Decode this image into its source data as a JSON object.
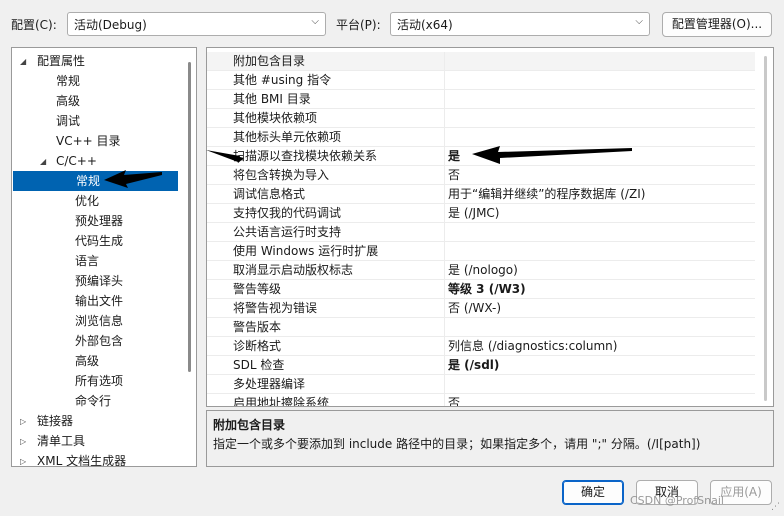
{
  "header": {
    "config_label": "配置(C):",
    "config_value": "活动(Debug)",
    "platform_label": "平台(P):",
    "platform_value": "活动(x64)",
    "config_manager_button": "配置管理器(O)..."
  },
  "tree": {
    "items": [
      {
        "label": "配置属性",
        "toggle": "◢"
      },
      {
        "label": "常规",
        "toggle": ""
      },
      {
        "label": "高级",
        "toggle": ""
      },
      {
        "label": "调试",
        "toggle": ""
      },
      {
        "label": "VC++ 目录",
        "toggle": ""
      },
      {
        "label": "C/C++",
        "toggle": "◢"
      },
      {
        "label": "常规",
        "toggle": "",
        "selected": true
      },
      {
        "label": "优化",
        "toggle": ""
      },
      {
        "label": "预处理器",
        "toggle": ""
      },
      {
        "label": "代码生成",
        "toggle": ""
      },
      {
        "label": "语言",
        "toggle": ""
      },
      {
        "label": "预编译头",
        "toggle": ""
      },
      {
        "label": "输出文件",
        "toggle": ""
      },
      {
        "label": "浏览信息",
        "toggle": ""
      },
      {
        "label": "外部包含",
        "toggle": ""
      },
      {
        "label": "高级",
        "toggle": ""
      },
      {
        "label": "所有选项",
        "toggle": ""
      },
      {
        "label": "命令行",
        "toggle": ""
      },
      {
        "label": "链接器",
        "toggle": "▷"
      },
      {
        "label": "清单工具",
        "toggle": "▷"
      },
      {
        "label": "XML 文档生成器",
        "toggle": "▷"
      }
    ]
  },
  "properties": [
    {
      "name": "附加包含目录",
      "value": ""
    },
    {
      "name": "其他 #using 指令",
      "value": ""
    },
    {
      "name": "其他 BMI 目录",
      "value": ""
    },
    {
      "name": "其他模块依赖项",
      "value": ""
    },
    {
      "name": "其他标头单元依赖项",
      "value": ""
    },
    {
      "name": "扫描源以查找模块依赖关系",
      "value": "是",
      "bold": true
    },
    {
      "name": "将包含转换为导入",
      "value": "否"
    },
    {
      "name": "调试信息格式",
      "value": "用于“编辑并继续”的程序数据库 (/ZI)"
    },
    {
      "name": "支持仅我的代码调试",
      "value": "是 (/JMC)"
    },
    {
      "name": "公共语言运行时支持",
      "value": ""
    },
    {
      "name": "使用 Windows 运行时扩展",
      "value": ""
    },
    {
      "name": "取消显示启动版权标志",
      "value": "是 (/nologo)"
    },
    {
      "name": "警告等级",
      "value": "等级 3 (/W3)",
      "bold": true
    },
    {
      "name": "将警告视为错误",
      "value": "否 (/WX-)"
    },
    {
      "name": "警告版本",
      "value": ""
    },
    {
      "name": "诊断格式",
      "value": "列信息 (/diagnostics:column)"
    },
    {
      "name": "SDL 检查",
      "value": "是 (/sdl)",
      "bold": true
    },
    {
      "name": "多处理器编译",
      "value": ""
    },
    {
      "name": "启用地址擦除系统",
      "value": "否"
    }
  ],
  "description": {
    "title": "附加包含目录",
    "text": "指定一个或多个要添加到 include 路径中的目录；如果指定多个，请用 \";\" 分隔。(/I[path])"
  },
  "footer": {
    "ok_label": "确定",
    "cancel_label": "取消",
    "apply_label": "应用(A)"
  },
  "watermark": "CSDN @ProfSnail",
  "colors": {
    "selection": "#0063b1",
    "primary_border": "#0a64c8",
    "annotation_arrow": "#000000"
  }
}
